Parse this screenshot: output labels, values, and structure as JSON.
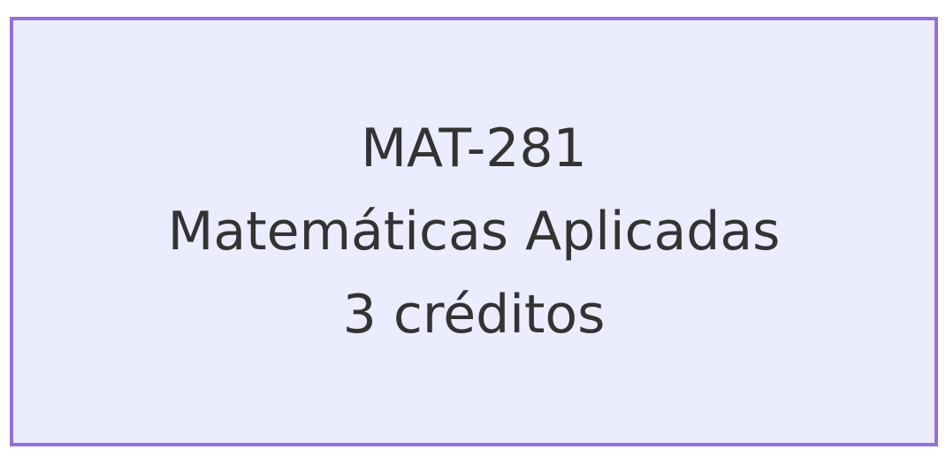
{
  "node": {
    "code": "MAT-281",
    "name": "Matemáticas Aplicadas",
    "credits": "3 créditos"
  },
  "colors": {
    "fill": "#ececff",
    "border": "#9370db",
    "text": "#333333"
  }
}
